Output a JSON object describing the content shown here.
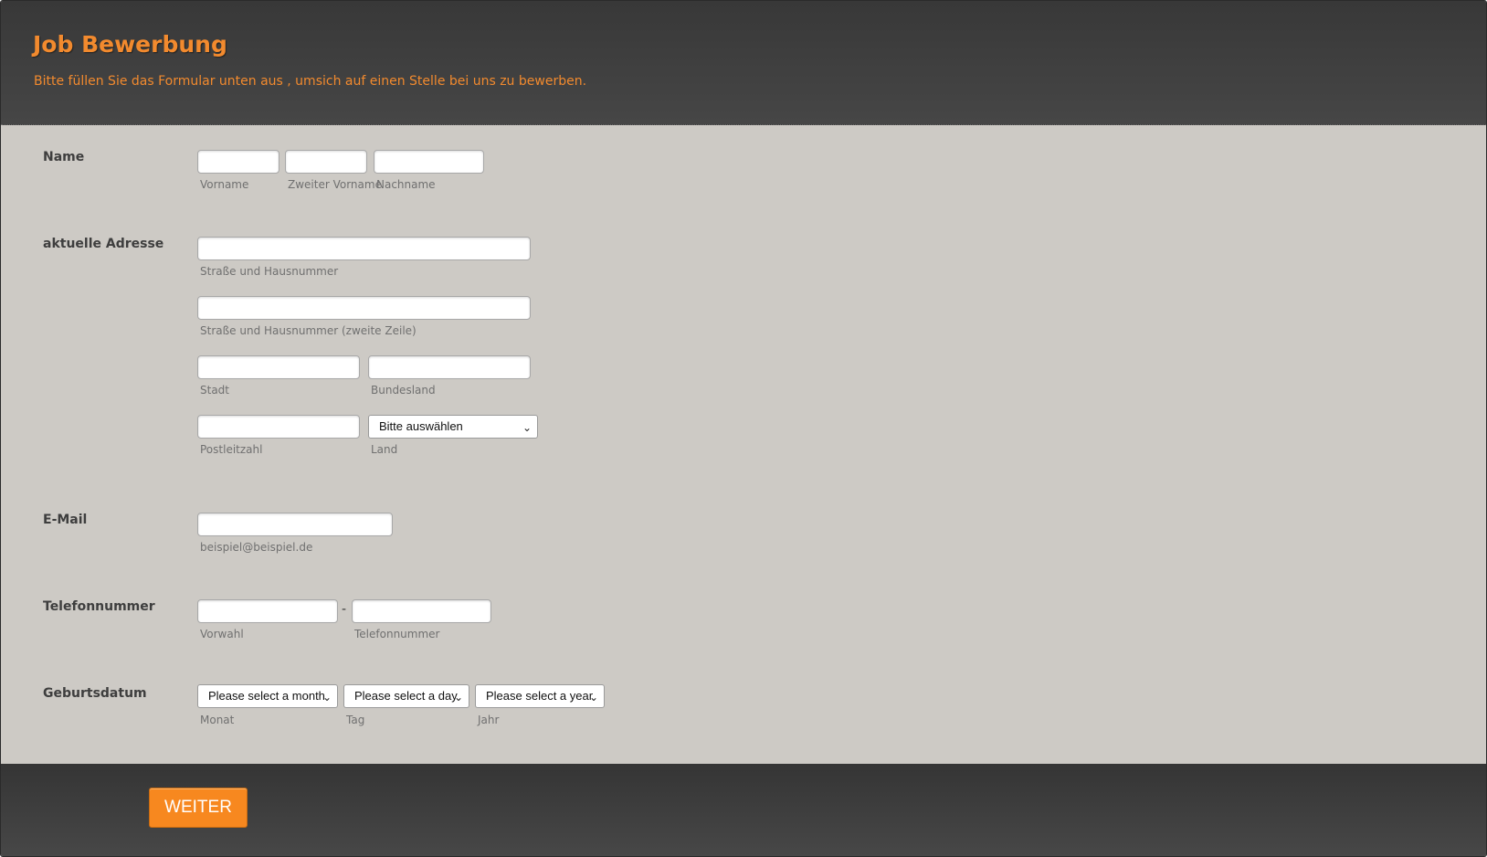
{
  "header": {
    "title": "Job Bewerbung",
    "subtitle": "Bitte füllen Sie das Formular unten aus , umsich auf einen Stelle bei uns zu bewerben."
  },
  "fields": {
    "name": {
      "label": "Name",
      "sub_first": "Vorname",
      "sub_middle": "Zweiter Vorname",
      "sub_last": "Nachname"
    },
    "address": {
      "label": "aktuelle Adresse",
      "sub_street1": "Straße und Hausnummer",
      "sub_street2": "Straße und Hausnummer (zweite Zeile)",
      "sub_city": "Stadt",
      "sub_state": "Bundesland",
      "sub_zip": "Postleitzahl",
      "sub_country": "Land",
      "country_selected": "Bitte auswählen"
    },
    "email": {
      "label": "E-Mail",
      "sub": "beispiel@beispiel.de"
    },
    "phone": {
      "label": "Telefonnummer",
      "separator": "-",
      "sub_area": "Vorwahl",
      "sub_number": "Telefonnummer"
    },
    "birthdate": {
      "label": "Geburtsdatum",
      "month_selected": "Please select a month",
      "day_selected": "Please select a day",
      "year_selected": "Please select a year",
      "sub_month": "Monat",
      "sub_day": "Tag",
      "sub_year": "Jahr"
    }
  },
  "footer": {
    "next_label": "WEITER"
  },
  "colors": {
    "accent": "#f7881f",
    "header_bg": "#3e3e3e",
    "form_bg": "#cdcac5"
  },
  "icons": {
    "select_arrow": "chevron-down-icon"
  }
}
